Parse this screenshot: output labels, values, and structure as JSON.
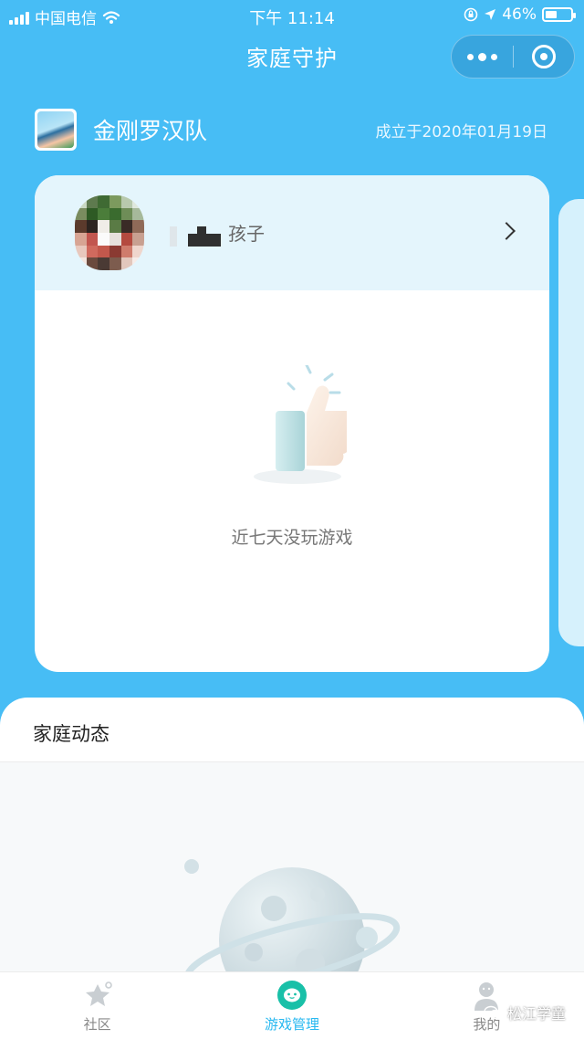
{
  "status_bar": {
    "carrier": "中国电信",
    "time": "下午 11:14",
    "battery_percent": "46%",
    "battery_level": 0.46,
    "icons": [
      "signal-icon",
      "wifi-icon",
      "rotation-lock-icon",
      "location-icon",
      "battery-icon"
    ]
  },
  "nav": {
    "title": "家庭守护",
    "icons": [
      "more-icon",
      "close-mini-program-icon"
    ]
  },
  "family": {
    "name": "金刚罗汉队",
    "founded": "成立于2020年01月19日"
  },
  "child_card": {
    "role": "孩子",
    "empty_message": "近七天没玩游戏",
    "icons": [
      "chevron-right-icon",
      "thumbs-up-icon"
    ]
  },
  "dynamics": {
    "title": "家庭动态",
    "icons": [
      "planet-icon"
    ]
  },
  "tabbar": {
    "tabs": [
      {
        "label": "社区",
        "icon": "community-star-icon",
        "active": false
      },
      {
        "label": "游戏管理",
        "icon": "game-manage-icon",
        "active": true
      },
      {
        "label": "我的",
        "icon": "profile-icon",
        "active": false
      }
    ]
  },
  "watermark": {
    "text": "松江学童"
  },
  "colors": {
    "primary": "#47bdf5",
    "accent": "#27b8f0",
    "card_head": "#e4f5fc"
  }
}
